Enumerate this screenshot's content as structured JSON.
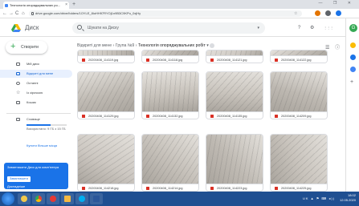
{
  "browser": {
    "tab_title": "Технологія опоряджувальних ро...",
    "tab_close": "×",
    "new_tab": "+",
    "window_controls": "— ❐ ✕",
    "nav": {
      "back": "←",
      "forward": "→",
      "reload": "C",
      "home": "⌂"
    },
    "url": "drive.google.com/drive/folders/1OYLE_8ioHH97RYOj1n9B3C9KPu_0xjHy",
    "star": "☆"
  },
  "drive": {
    "brand": "Диск",
    "search_placeholder": "Шукати на Диску",
    "header_icons": [
      "?",
      "⚙",
      "⋮⋮⋮"
    ],
    "new_button": "Створити",
    "sidebar": [
      {
        "label": "Мій диск",
        "icon": "my-drive-icon"
      },
      {
        "label": "Відкриті для мене",
        "icon": "shared-icon",
        "active": true
      },
      {
        "label": "Останні",
        "icon": "recent-icon"
      },
      {
        "label": "Із зірочкою",
        "icon": "star-icon"
      },
      {
        "label": "Кошик",
        "icon": "trash-icon"
      },
      {
        "label": "Сховище",
        "icon": "storage-icon"
      }
    ],
    "storage_text": "Використано: 9 ГБ з 15 ГБ",
    "storage_fraction": 0.6,
    "buy_storage": "Купити більше місця",
    "promo": {
      "text": "Завантажити Диск для комп'ютера",
      "button": "Завантажити",
      "link": "Докладніше"
    },
    "breadcrumb": [
      "Відкриті для мене",
      "Група №9",
      "Технологія опоряджувальних робіт"
    ],
    "files": [
      "20200408_114119.jpg",
      "20200408_114118.jpg",
      "20200408_114121.jpg",
      "20200408_114122.jpg",
      "20200408_114129.jpg",
      "20200408_114132.jpg",
      "20200408_114135.jpg",
      "20200408_114209.jpg",
      "20200408_114218.jpg",
      "20200408_114214.jpg",
      "20200408_114223.jpg",
      "20200408_114225.jpg"
    ]
  },
  "taskbar": {
    "tray": "UK ▲ ⚑ ⌨ ◂))",
    "time": "18:02",
    "date": "12.05.2020"
  },
  "colors": {
    "accent": "#1a73e8",
    "selected_bg": "#e8f0fe",
    "taskbar": "#1f4f91",
    "image_badge": "#d93025"
  }
}
